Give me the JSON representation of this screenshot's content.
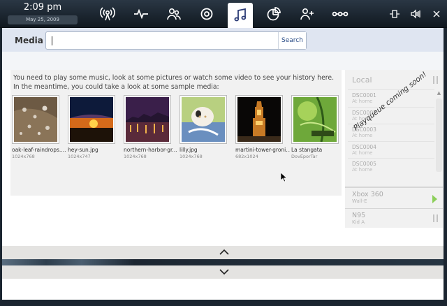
{
  "clock": {
    "time": "2:09 pm",
    "date": "May 25, 2009"
  },
  "nav_icons": [
    "broadcast-icon",
    "activity-icon",
    "people-icon",
    "target-icon",
    "music-icon",
    "pie-chart-icon",
    "add-contact-icon",
    "options-icon"
  ],
  "active_nav": "music-icon",
  "tray_icons": [
    "network-icon",
    "volume-icon",
    "close-icon"
  ],
  "search": {
    "label": "Media",
    "value": "",
    "button": "Search"
  },
  "history": {
    "message": "You need to play some music, look at some pictures or watch some video to see your history here. In the meantime, you could take a look at some sample media:",
    "items": [
      {
        "name": "oak-leaf-raindrops....",
        "dims": "1024x768"
      },
      {
        "name": "hey-sun.jpg",
        "dims": "1024x747"
      },
      {
        "name": "northern-harbor-gr...",
        "dims": "1024x768"
      },
      {
        "name": "lilly.jpg",
        "dims": "1024x768"
      },
      {
        "name": "martini-tower-groni...",
        "dims": "682x1024"
      },
      {
        "name": "La stangata",
        "dims": "DovEporTar"
      }
    ]
  },
  "side": {
    "local_title": "Local",
    "local_items": [
      {
        "name": "DSC0001",
        "sub": "At home"
      },
      {
        "name": "DSC0002",
        "sub": "At home"
      },
      {
        "name": "DSC0003",
        "sub": "At home"
      },
      {
        "name": "DSC0004",
        "sub": "At home"
      },
      {
        "name": "DSC0005",
        "sub": "At home"
      }
    ],
    "stamp": "Playqueue coming soon!",
    "devices": [
      {
        "name": "Xbox 360",
        "sub": "Wall-E"
      },
      {
        "name": "N95",
        "sub": "Kid A"
      }
    ]
  },
  "colors": {
    "accent": "#2b4d87",
    "topbar": "#1b2530",
    "search_band": "#dfe5f1",
    "play": "#8ccf5a"
  }
}
